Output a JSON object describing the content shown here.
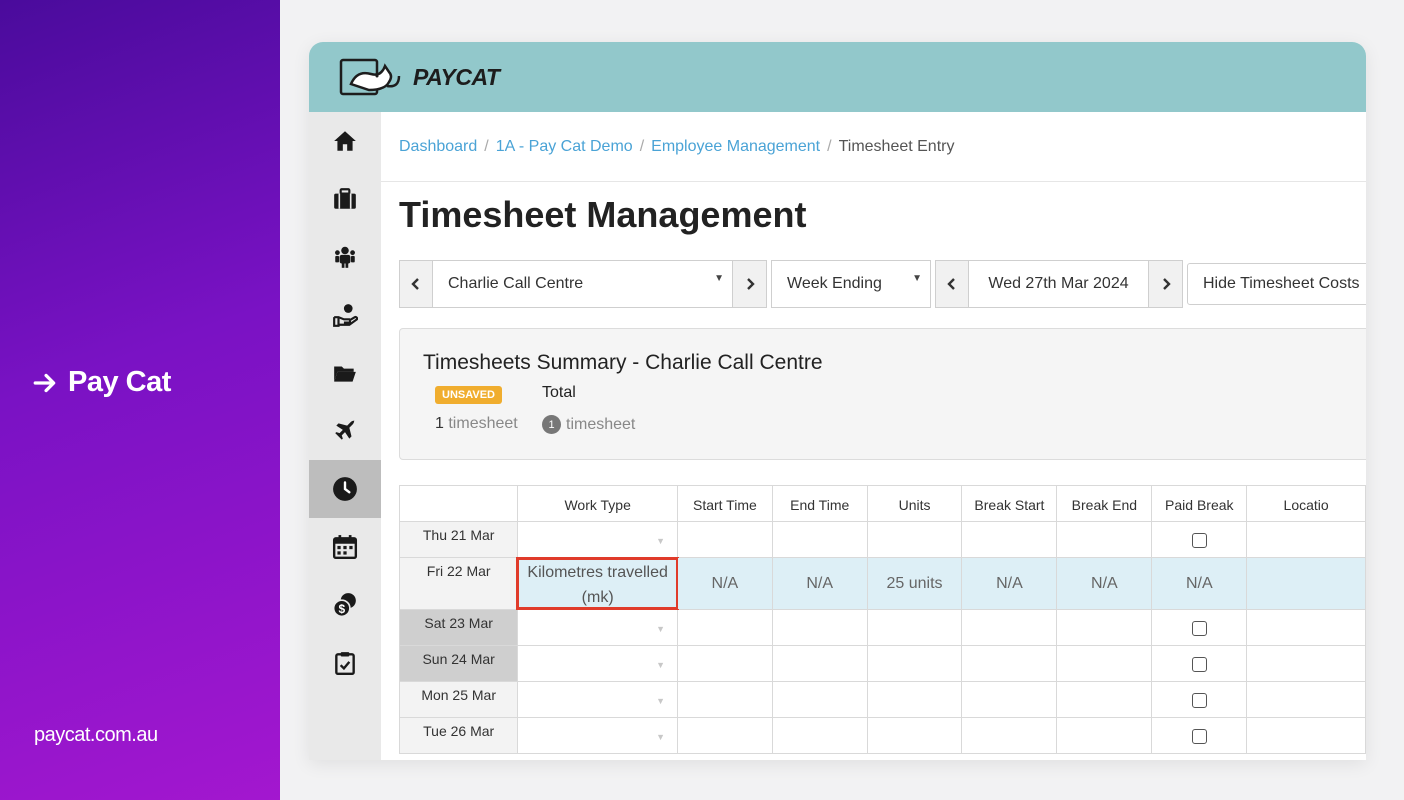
{
  "promo": {
    "title": "Pay Cat",
    "site": "paycat.com.au"
  },
  "app": {
    "logo_text": "PAYCAT"
  },
  "sidebar": {
    "items": [
      {
        "icon": "home-icon"
      },
      {
        "icon": "briefcase-icon"
      },
      {
        "icon": "people-icon"
      },
      {
        "icon": "hand-coin-icon"
      },
      {
        "icon": "folder-icon"
      },
      {
        "icon": "plane-icon"
      },
      {
        "icon": "clock-icon",
        "active": true
      },
      {
        "icon": "calendar-icon"
      },
      {
        "icon": "coins-icon"
      },
      {
        "icon": "clipboard-check-icon"
      }
    ]
  },
  "breadcrumb": [
    "Dashboard",
    "1A - Pay Cat Demo",
    "Employee Management",
    "Timesheet Entry"
  ],
  "page_title": "Timesheet Management",
  "controls": {
    "location": "Charlie Call Centre",
    "period": "Week Ending",
    "date": "Wed 27th Mar 2024",
    "hide_costs": "Hide Timesheet Costs"
  },
  "summary": {
    "title": "Timesheets Summary - Charlie Call Centre",
    "badge": "UNSAVED",
    "total_label": "Total",
    "unsaved_count": "1",
    "unsaved_unit": "timesheet",
    "total_count": "1",
    "total_unit": "timesheet"
  },
  "table": {
    "headers": [
      "",
      "Work Type",
      "Start Time",
      "End Time",
      "Units",
      "Break Start",
      "Break End",
      "Paid Break",
      "Locatio"
    ],
    "rows": [
      {
        "day": "Thu 21 Mar"
      },
      {
        "day": "Fri 22 Mar",
        "work_type": "Kilometres travelled (mk)",
        "start": "N/A",
        "end": "N/A",
        "units": "25 units",
        "break_start": "N/A",
        "break_end": "N/A",
        "paid_break": "N/A"
      },
      {
        "day": "Sat 23 Mar"
      },
      {
        "day": "Sun 24 Mar"
      },
      {
        "day": "Mon 25 Mar"
      },
      {
        "day": "Tue 26 Mar"
      }
    ]
  },
  "colors": {
    "accent_purple": "#7a12c4",
    "topbar": "#92c8cb",
    "link": "#4aa3d6",
    "badge": "#f0ad2e",
    "highlight_border": "#e03b2a"
  }
}
